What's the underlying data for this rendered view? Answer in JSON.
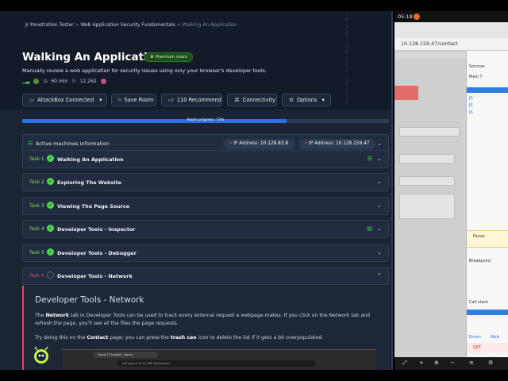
{
  "breadcrumb": {
    "items": [
      "Jr Penetration Tester",
      "Web Application Security Fundamentals"
    ],
    "current": "Walking An Application",
    "separator": ">"
  },
  "room": {
    "title": "Walking An Application",
    "badge": "Premium room",
    "subtitle": "Manually review a web application for security issues using only your browser's developer tools.",
    "duration": "60 min",
    "users": "12,262"
  },
  "actions": {
    "attackbox": "AttackBox Connected",
    "save": "Save Room",
    "recommend": "110 Recommend",
    "connectivity": "Connectivity",
    "options": "Options"
  },
  "progress": {
    "label": "Room progress: 72%",
    "value": 0.72
  },
  "machines": {
    "label": "Active machines information",
    "ip1_label": "IP Address:",
    "ip1": "10.128.83.8",
    "ip2_label": "IP Address:",
    "ip2": "10.128.159.47"
  },
  "tasks": [
    {
      "num": "Task 1",
      "title": "Walking An Application"
    },
    {
      "num": "Task 2",
      "title": "Exploring The Website"
    },
    {
      "num": "Task 3",
      "title": "Viewing The Page Source"
    },
    {
      "num": "Task 4",
      "title": "Developer Tools - Inspector"
    },
    {
      "num": "Task 5",
      "title": "Developer Tools - Debugger"
    },
    {
      "num": "Task 6",
      "title": "Developer Tools - Network"
    }
  ],
  "task6_body": {
    "heading": "Developer Tools - Network",
    "p1_pre": "The ",
    "p1_bold": "Network",
    "p1_post": " tab in Developer Tools can be used to track every external request a webpage makes. If you click on the Network tab and refresh the page, you'll see all the files the page requests.",
    "p2_pre": "Try doing this on the ",
    "p2_bold1": "Contact",
    "p2_mid": " page; you can press the ",
    "p2_bold2": "trash can",
    "p2_post": " icon to delete the list if it gets a bit overpopulated.",
    "mini_tab": "Acme IT Support - Home",
    "mini_url": "Not secure   10.10.186.161/contact"
  },
  "browser": {
    "clock": "05:18",
    "url": "10.128.159.47/contact"
  },
  "devtools": {
    "sources_tab": "Sources",
    "main_label": "Main T",
    "pause_label": "Pause",
    "breakpoints": "Breakpoint",
    "call_stack": "Call stack",
    "errors": "Errors",
    "web": "Web",
    "get_label": "GET"
  },
  "colors": {
    "accent_green": "#4fd44a",
    "accent_red": "#e5485b",
    "progress_blue": "#2f6fe4"
  }
}
